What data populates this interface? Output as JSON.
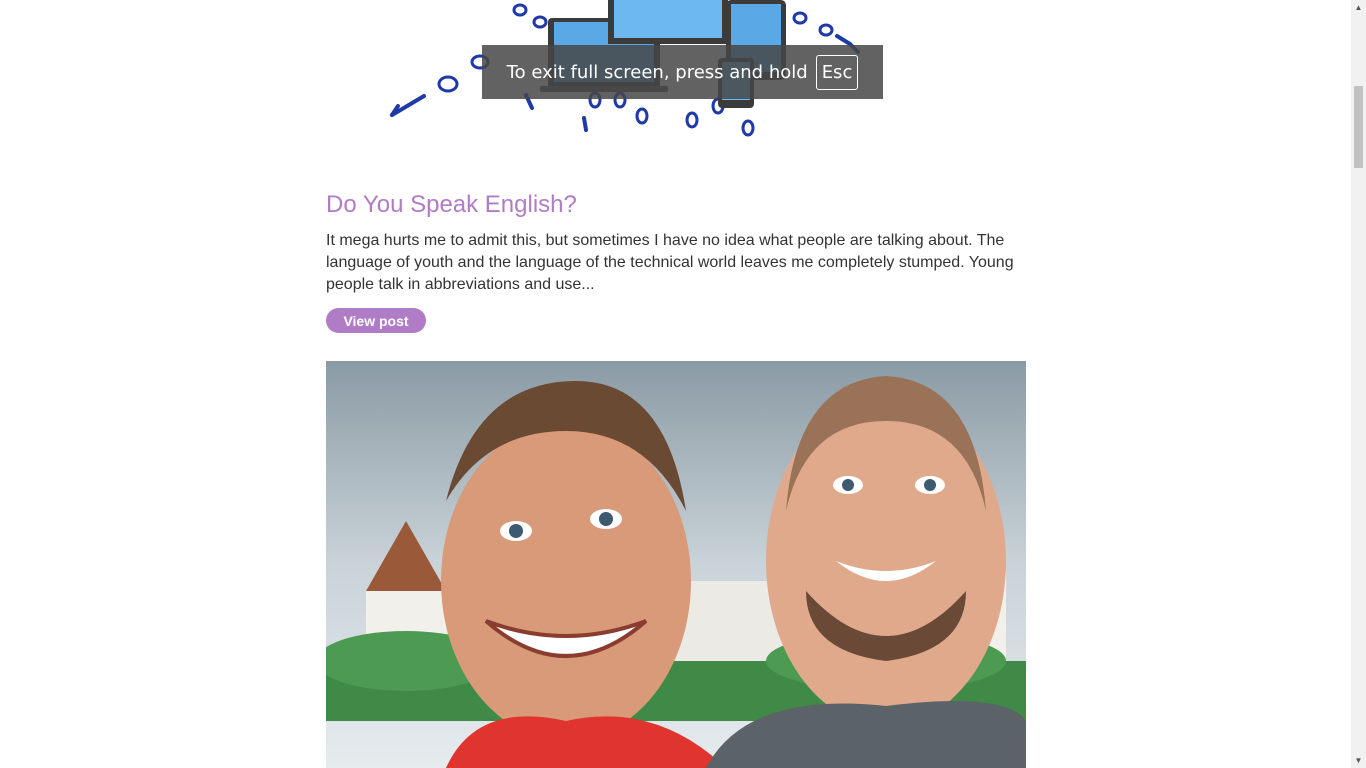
{
  "post": {
    "title": "Do You Speak English?",
    "excerpt": "It mega hurts me to admit this, but sometimes I have no idea what people are talking about. The language of youth and the language of the technical world leaves me completely stumped. Young people talk in abbreviations and use...",
    "view_label": "View post"
  },
  "fullscreen_notice": {
    "text": "To exit full screen, press and hold",
    "key": "Esc"
  },
  "colors": {
    "accent": "#b07cc6",
    "text": "#333333",
    "binary_blue": "#1f3aa8"
  }
}
